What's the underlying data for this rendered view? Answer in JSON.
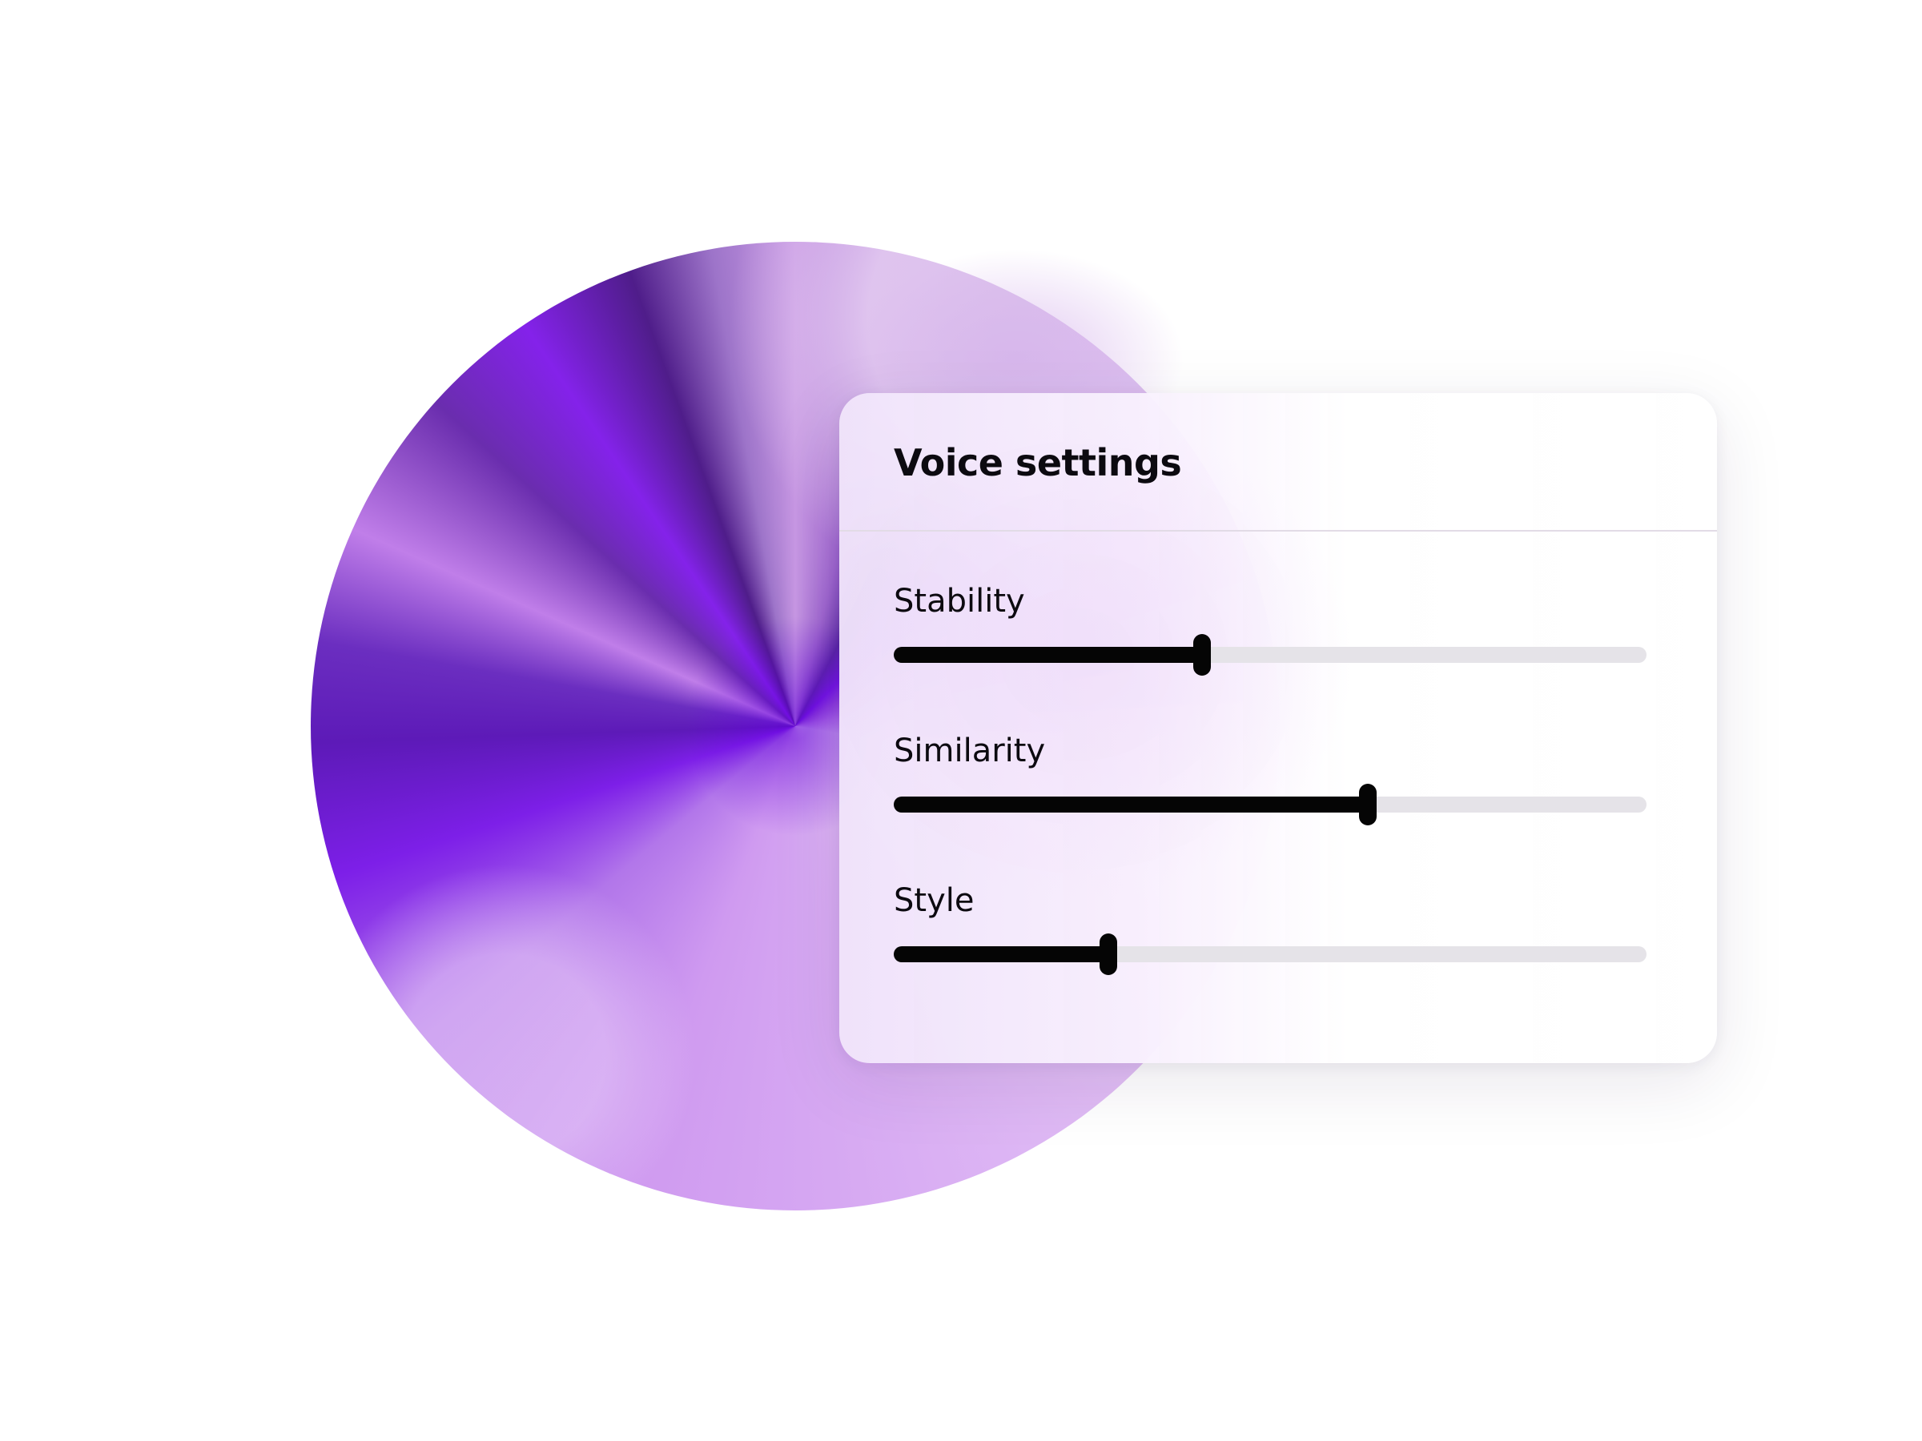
{
  "panel": {
    "title": "Voice settings",
    "sliders": [
      {
        "label": "Stability",
        "value": 0.41
      },
      {
        "label": "Similarity",
        "value": 0.63
      },
      {
        "label": "Style",
        "value": 0.285
      }
    ]
  },
  "colors": {
    "orb_primary": "#7a1fe6",
    "orb_light": "#e3c2f5",
    "track": "#e5e3e8",
    "fill": "#050505",
    "text": "#0c0a10"
  }
}
